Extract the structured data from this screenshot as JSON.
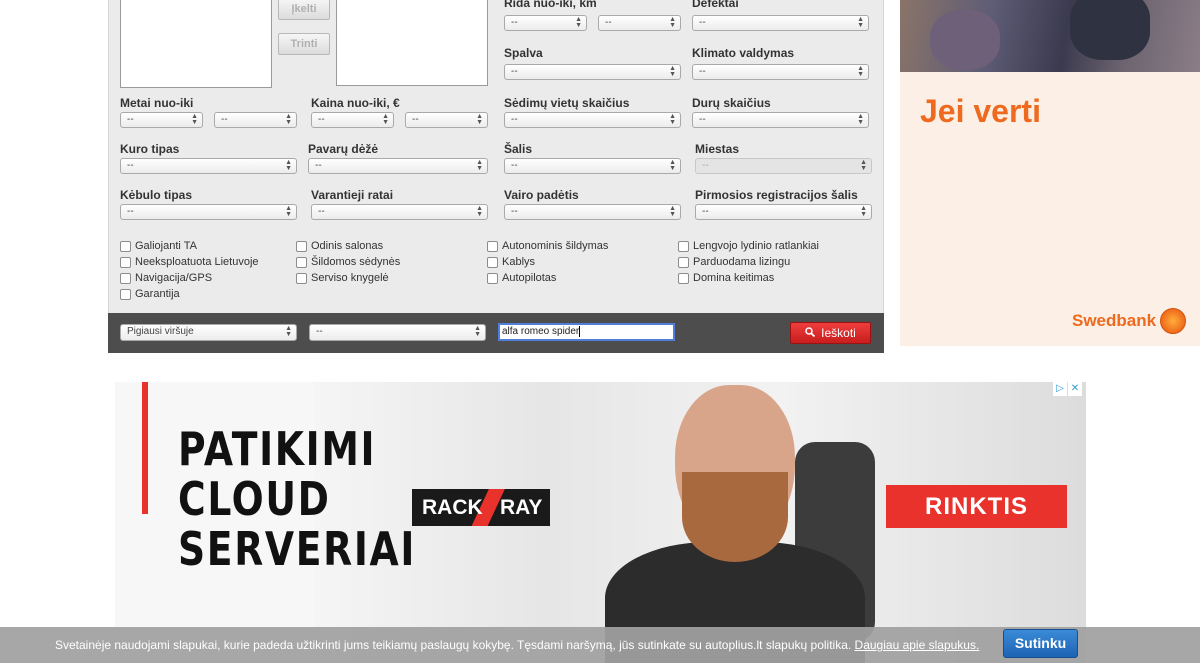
{
  "buttons": {
    "upload": "Įkelti",
    "delete": "Trinti"
  },
  "fields": {
    "mileage": {
      "label": "Rida nuo-iki, km",
      "from": "--",
      "to": "--"
    },
    "defects": {
      "label": "Defektai",
      "value": "--"
    },
    "color": {
      "label": "Spalva",
      "value": "--"
    },
    "climate": {
      "label": "Klimato valdymas",
      "value": "--"
    },
    "year": {
      "label": "Metai nuo-iki",
      "from": "--",
      "to": "--"
    },
    "price": {
      "label": "Kaina nuo-iki, €",
      "from": "--",
      "to": "--"
    },
    "seats": {
      "label": "Sėdimų vietų skaičius",
      "value": "--"
    },
    "doors": {
      "label": "Durų skaičius",
      "value": "--"
    },
    "fuel": {
      "label": "Kuro tipas",
      "value": "--"
    },
    "gearbox": {
      "label": "Pavarų dėžė",
      "value": "--"
    },
    "country": {
      "label": "Šalis",
      "value": "--"
    },
    "city": {
      "label": "Miestas",
      "value": "--"
    },
    "body": {
      "label": "Kėbulo tipas",
      "value": "--"
    },
    "drive": {
      "label": "Varantieji ratai",
      "value": "--"
    },
    "steering": {
      "label": "Vairo padėtis",
      "value": "--"
    },
    "first_reg": {
      "label": "Pirmosios registracijos šalis",
      "value": "--"
    }
  },
  "checkboxes": [
    "Galiojanti TA",
    "Neeksploatuota Lietuvoje",
    "Navigacija/GPS",
    "Garantija",
    "Odinis salonas",
    "Šildomos sėdynės",
    "Serviso knygelė",
    "Autonominis šildymas",
    "Kablys",
    "Autopilotas",
    "Lengvojo lydinio ratlankiai",
    "Parduodama lizingu",
    "Domina keitimas"
  ],
  "search_bar": {
    "sort": "Pigiausi viršuje",
    "second": "--",
    "query": "alfa romeo spider",
    "button": "Ieškoti"
  },
  "ad_right": {
    "headline": "Jei verti",
    "brand": "Swedbank"
  },
  "ad_bottom": {
    "lines": [
      "PATIKIMI",
      "CLOUD",
      "SERVERIAI"
    ],
    "logo_left": "RACK",
    "logo_right": "RAY",
    "cta": "RINKTIS",
    "choices": [
      "▷",
      "✕"
    ]
  },
  "cookie": {
    "text": "Svetainėje naudojami slapukai, kurie padeda užtikrinti jums teikiamų paslaugų kokybę. Tęsdami naršymą, jūs sutinkate su autoplius.lt slapukų politika.",
    "link": "Daugiau apie slapukus.",
    "button": "Sutinku"
  },
  "colors": {
    "accent_red": "#e8322b",
    "swedbank_orange": "#ee6a1e",
    "cookie_button": "#1e63b4"
  }
}
